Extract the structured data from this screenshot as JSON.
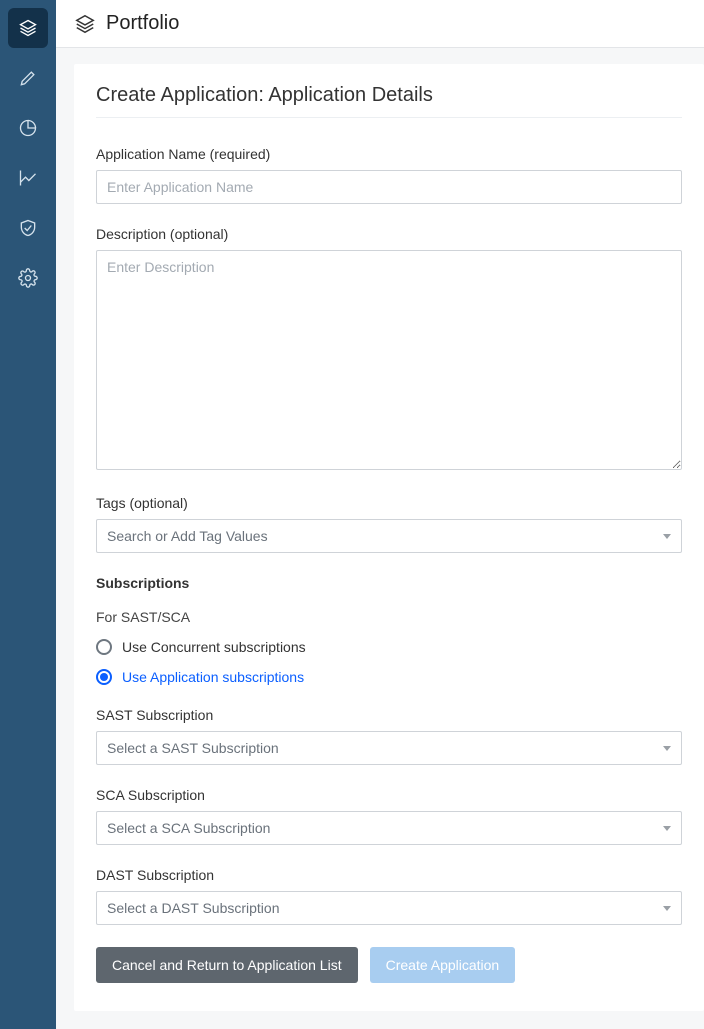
{
  "header": {
    "title": "Portfolio"
  },
  "page": {
    "title": "Create Application: Application Details"
  },
  "form": {
    "appName": {
      "label": "Application Name (required)",
      "placeholder": "Enter Application Name",
      "value": ""
    },
    "description": {
      "label": "Description (optional)",
      "placeholder": "Enter Description",
      "value": ""
    },
    "tags": {
      "label": "Tags (optional)",
      "placeholder": "Search or Add Tag Values"
    },
    "subscriptions": {
      "heading": "Subscriptions",
      "subLabel": "For SAST/SCA",
      "radio": {
        "concurrent": "Use Concurrent subscriptions",
        "application": "Use Application subscriptions",
        "selected": "application"
      },
      "sast": {
        "label": "SAST Subscription",
        "placeholder": "Select a SAST Subscription"
      },
      "sca": {
        "label": "SCA Subscription",
        "placeholder": "Select a SCA Subscription"
      },
      "dast": {
        "label": "DAST Subscription",
        "placeholder": "Select a DAST Subscription"
      }
    }
  },
  "buttons": {
    "cancel": "Cancel and Return to Application List",
    "create": "Create Application"
  }
}
